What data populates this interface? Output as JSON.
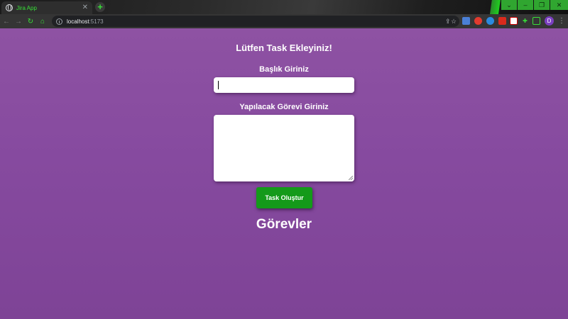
{
  "browser": {
    "tab_title": "Jira App",
    "tab_close": "✕",
    "new_tab": "+",
    "url_host": "localhost",
    "url_port": ":5173",
    "nav": {
      "back": "←",
      "forward": "→",
      "reload": "↻",
      "home": "⌂"
    },
    "window_controls": {
      "tab_search": "⌄",
      "minimize": "–",
      "restore": "❐",
      "close": "✕"
    },
    "omnibox_actions": {
      "share": "⇪",
      "bookmark": "☆"
    },
    "profile_initial": "D",
    "menu": "⋮",
    "colors": {
      "accent": "#38e038",
      "window_controls": "#30a630"
    }
  },
  "app": {
    "form_title": "Lütfen Task Ekleyiniz!",
    "title_label": "Başlık Giriniz",
    "title_value": "",
    "description_label": "Yapılacak Görevi Giriniz",
    "description_value": "",
    "submit_label": "Task Oluştur",
    "tasks_heading": "Görevler",
    "colors": {
      "background": "#8a4ea0",
      "button": "#149a1a",
      "text": "#ffffff"
    }
  }
}
